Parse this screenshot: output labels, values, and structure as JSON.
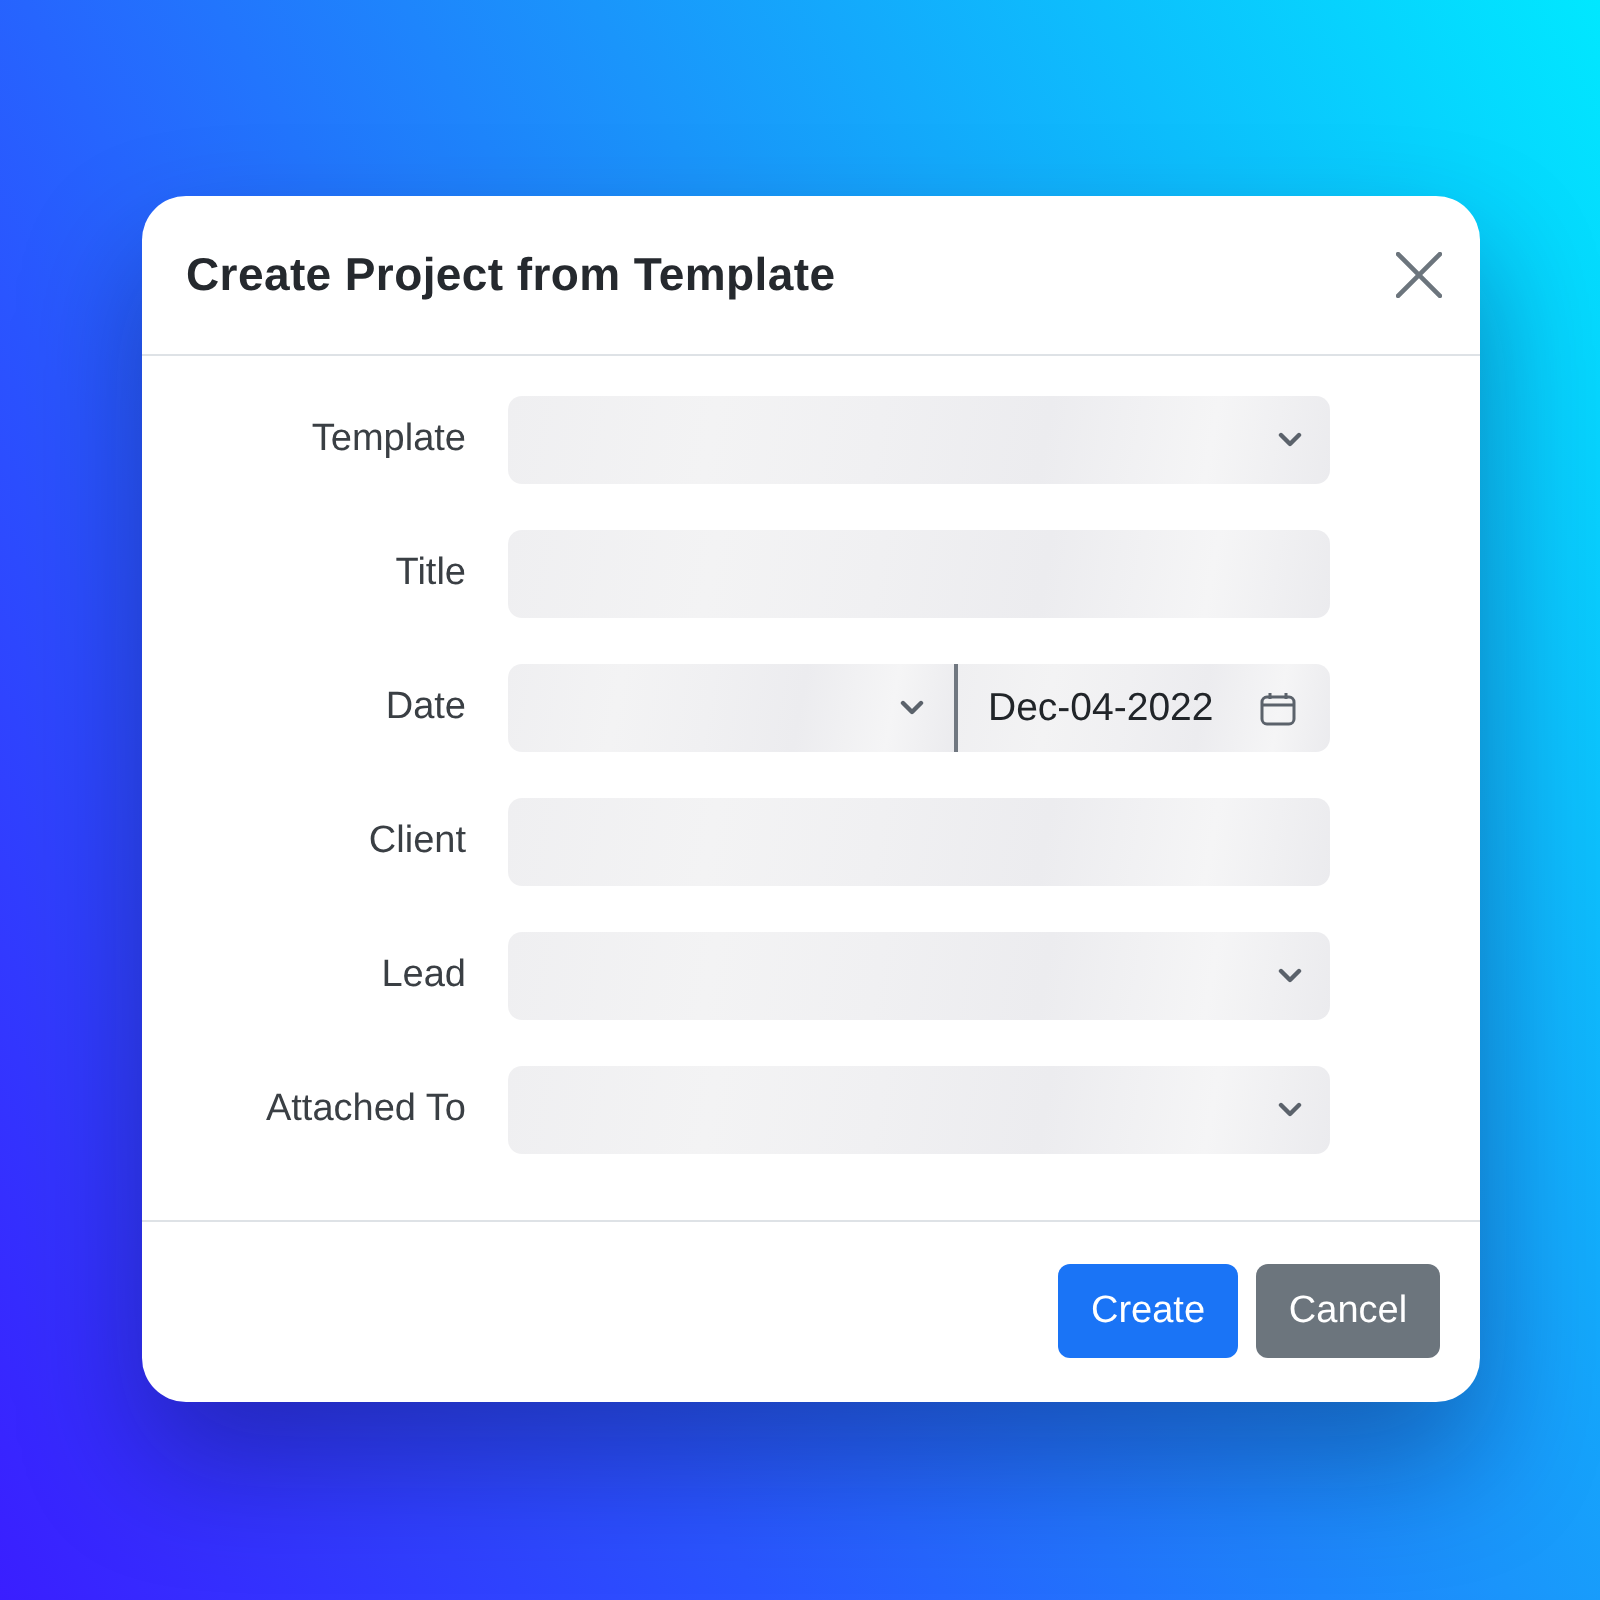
{
  "dialog": {
    "title": "Create Project from Template"
  },
  "form": {
    "loading": true,
    "fields": [
      {
        "label": "Template",
        "kind": "select"
      },
      {
        "label": "Title",
        "kind": "text"
      },
      {
        "label": "Date",
        "kind": "select-date",
        "value": "Dec-04-2022"
      },
      {
        "label": "Client",
        "kind": "text"
      },
      {
        "label": "Lead",
        "kind": "select"
      },
      {
        "label": "Attached To",
        "kind": "select"
      }
    ]
  },
  "buttons": [
    {
      "label": "Create",
      "kind": "primary"
    },
    {
      "label": "Cancel",
      "kind": "secondary"
    }
  ]
}
